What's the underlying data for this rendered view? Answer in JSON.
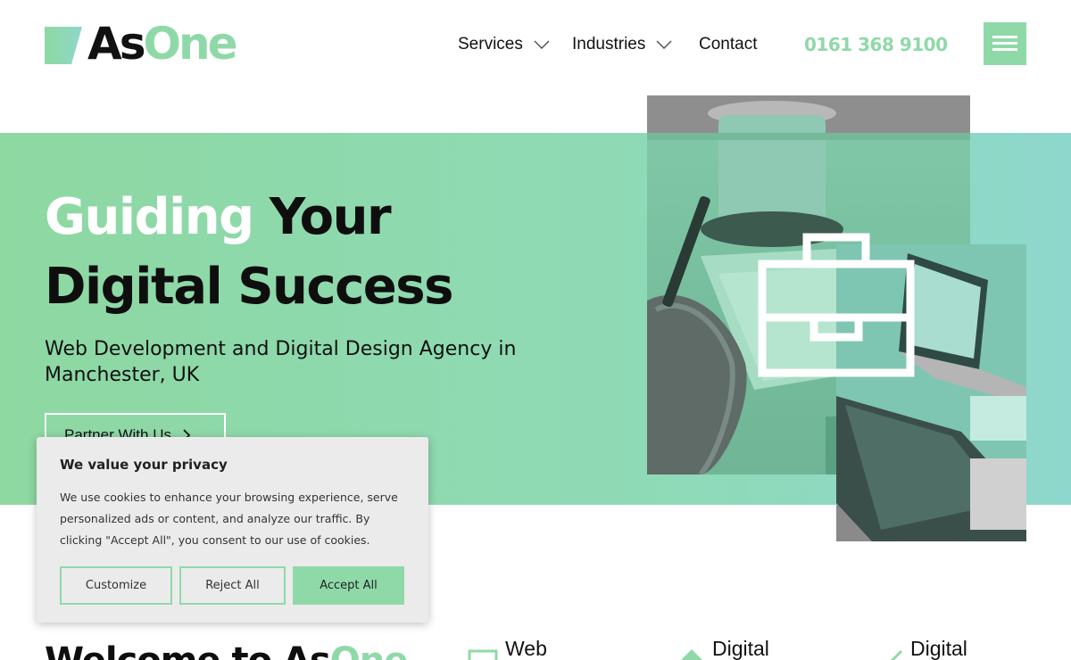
{
  "brand": {
    "as": "As",
    "one": "One",
    "accent": "#8fd9a8"
  },
  "nav": {
    "items": [
      {
        "label": "Services",
        "has_dropdown": true
      },
      {
        "label": "Industries",
        "has_dropdown": true
      },
      {
        "label": "Contact",
        "has_dropdown": false
      }
    ],
    "phone": "0161 368 9100",
    "menu_icon": "hamburger-icon"
  },
  "hero": {
    "title_light": "Guiding",
    "title_dark_1": "Your",
    "title_dark_2": "Digital Success",
    "subtitle": "Web Development and Digital Design Agency in Manchester, UK",
    "cta_label": "Partner With Us",
    "icon": "briefcase-icon"
  },
  "welcome": {
    "prefix": "Welcome to As",
    "accent": "One"
  },
  "services": [
    {
      "label": "Web",
      "icon": "web-icon"
    },
    {
      "label": "Digital",
      "icon": "diamond-icon"
    },
    {
      "label": "Digital",
      "icon": "growth-chart-icon"
    }
  ],
  "cookie": {
    "title": "We value your privacy",
    "text": "We use cookies to enhance your browsing experience, serve personalized ads or content, and analyze our traffic. By clicking \"Accept All\", you consent to our use of cookies.",
    "customize": "Customize",
    "reject": "Reject All",
    "accept": "Accept All"
  }
}
